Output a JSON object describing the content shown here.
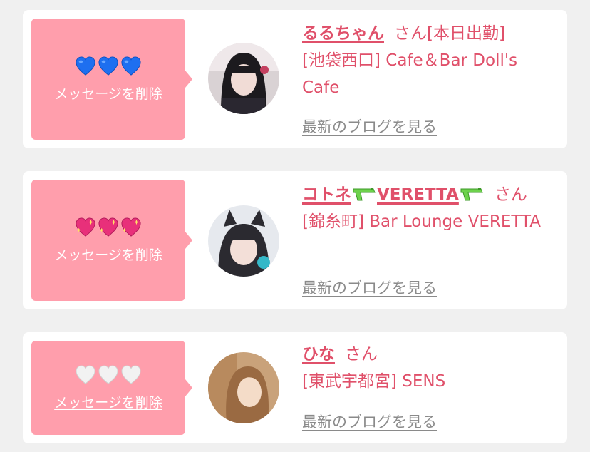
{
  "favorites": [
    {
      "hearts_icon": "blue-heart-icon",
      "hearts_count": 3,
      "delete_label": "メッセージを削除",
      "name": "るるちゃん",
      "name_suffix": "さん",
      "status": "[本日出勤]",
      "store": "[池袋西口] Cafe＆Bar Doll's Cafe",
      "blog_label": "最新のブログを見る"
    },
    {
      "hearts_icon": "sparkling-heart-icon",
      "hearts_count": 3,
      "delete_label": "メッセージを削除",
      "name_part1": "コトネ",
      "name_part2": "VERETTA",
      "name_icon": "water-pistol-icon",
      "name_suffix": "さん",
      "store": "[錦糸町] Bar Lounge VERETTA",
      "blog_label": "最新のブログを見る"
    },
    {
      "hearts_icon": "white-heart-icon",
      "hearts_count": 3,
      "delete_label": "メッセージを削除",
      "name": "ひな",
      "name_suffix": "さん",
      "store": "[東武宇都宮] SENS",
      "blog_label": "最新のブログを見る"
    }
  ],
  "colors": {
    "background": "#f0f0f0",
    "card": "#ffffff",
    "accent_pink": "#ff9eac",
    "name_pink": "#e0506a",
    "link_gray": "#8a8a8a",
    "heart_blue": "#1e6ff0",
    "heart_sparkle": "#e8307a",
    "heart_white": "#f2f2f2"
  }
}
